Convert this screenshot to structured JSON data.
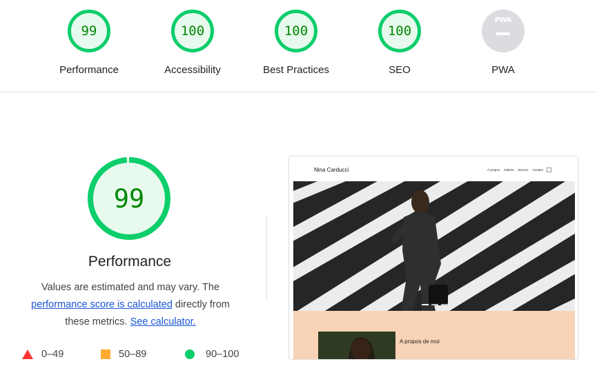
{
  "categories": [
    {
      "score": "99",
      "label": "Performance",
      "color": "#0cce6b"
    },
    {
      "score": "100",
      "label": "Accessibility",
      "color": "#0cce6b"
    },
    {
      "score": "100",
      "label": "Best Practices",
      "color": "#0cce6b"
    },
    {
      "score": "100",
      "label": "SEO",
      "color": "#0cce6b"
    },
    {
      "badge": "PWA",
      "label": "PWA",
      "color": "#dadce0"
    }
  ],
  "main": {
    "score": "99",
    "score_fraction": 0.99,
    "title": "Performance",
    "desc_part1": "Values are estimated and may vary. The ",
    "desc_link1": "performance score is calculated",
    "desc_part2": " directly from these metrics. ",
    "desc_link2": "See calculator."
  },
  "legend": [
    {
      "range": "0–49",
      "icon": "red-triangle",
      "color": "#ff3333"
    },
    {
      "range": "50–89",
      "icon": "orange-square",
      "color": "#ffaa33"
    },
    {
      "range": "90–100",
      "icon": "green-circle",
      "color": "#0cce6b"
    }
  ],
  "screenshot": {
    "site_name": "Nina Carducci",
    "nav": [
      "À propos",
      "Galerie",
      "Service",
      "Contact"
    ],
    "about_heading": "A propos de moi"
  }
}
